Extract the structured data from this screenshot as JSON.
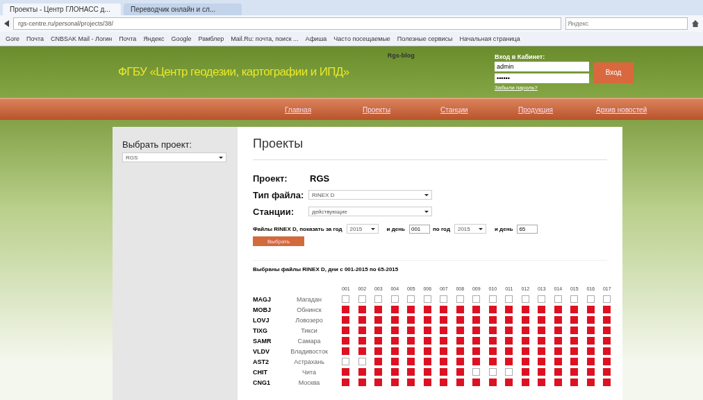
{
  "browser": {
    "tabs": [
      {
        "label": "Проекты - Центр ГЛОНАСС д...",
        "selected": true
      },
      {
        "label": "Переводчик онлайн и сл...",
        "selected": false
      }
    ],
    "address": "rgs-centre.ru/personal/projects/38/",
    "search": {
      "placeholder": "Яндекс"
    },
    "bookmarks": [
      "Gore",
      "Почта",
      "CNBSAK Mail - Логин",
      "Почта",
      "Яндекс",
      "Google",
      "Рамблер",
      "Mail.Ru: почта, поиск ...",
      "Афиша",
      "Часто посещаемые",
      "Полезные сервисы",
      "Начальная страница"
    ]
  },
  "header": {
    "title": "ФГБУ «Центр геодезии, картографии и ИПД»",
    "blog": "Rgs-blog",
    "login_title": "Вход в Кабинет:",
    "login": "admin",
    "password": "••••••",
    "login_button": "Вход",
    "forgot": "Забыли пароль?"
  },
  "nav": [
    {
      "label": "Главная"
    },
    {
      "label": "Проекты"
    },
    {
      "label": "Станции"
    },
    {
      "label": "Продукция"
    },
    {
      "label": "Архив новостей"
    }
  ],
  "sidebar": {
    "label": "Выбрать проект:",
    "value": "RGS"
  },
  "main": {
    "title": "Проекты",
    "project_label": "Проект:",
    "project": "RGS",
    "type_label": "Тип файла:",
    "type": "RINEX D",
    "stations_label": "Станции:",
    "stations": "действующие",
    "filter": {
      "text1": "Файлы RINEX D, показать за год",
      "year1": "2015",
      "text2": "и день",
      "day1": "001",
      "text3": "по год",
      "year2": "2015",
      "text4": "и день",
      "day2": "65"
    },
    "submit": "Выбрать",
    "result": "Выбраны файлы RINEX D, дни с 001-2015 по 65-2015"
  },
  "grid": {
    "columns": [
      "001",
      "002",
      "003",
      "004",
      "005",
      "006",
      "007",
      "008",
      "009",
      "010",
      "011",
      "012",
      "013",
      "014",
      "015",
      "016",
      "017"
    ],
    "rows": [
      {
        "code": "MAGJ",
        "city": "Магадан",
        "cells": [
          false,
          false,
          false,
          false,
          false,
          false,
          false,
          false,
          false,
          false,
          false,
          false,
          false,
          false,
          false,
          false,
          false
        ]
      },
      {
        "code": "MOBJ",
        "city": "Обнинск",
        "cells": [
          true,
          true,
          true,
          true,
          true,
          true,
          true,
          true,
          true,
          true,
          true,
          true,
          true,
          true,
          true,
          true,
          true
        ]
      },
      {
        "code": "LOVJ",
        "city": "Ловозеро",
        "cells": [
          true,
          true,
          true,
          true,
          true,
          true,
          true,
          true,
          true,
          true,
          true,
          true,
          true,
          true,
          true,
          true,
          true
        ]
      },
      {
        "code": "TIXG",
        "city": "Тикси",
        "cells": [
          true,
          true,
          true,
          true,
          true,
          true,
          true,
          true,
          true,
          true,
          true,
          true,
          true,
          true,
          true,
          true,
          true
        ]
      },
      {
        "code": "SAMR",
        "city": "Самара",
        "cells": [
          true,
          true,
          true,
          true,
          true,
          true,
          true,
          true,
          true,
          true,
          true,
          true,
          true,
          true,
          true,
          true,
          true
        ]
      },
      {
        "code": "VLDV",
        "city": "Владивосток",
        "cells": [
          true,
          true,
          true,
          true,
          true,
          true,
          true,
          true,
          true,
          true,
          true,
          true,
          true,
          true,
          true,
          true,
          true
        ]
      },
      {
        "code": "AST2",
        "city": "Астрахань",
        "cells": [
          false,
          false,
          true,
          true,
          true,
          true,
          true,
          true,
          true,
          true,
          true,
          true,
          true,
          true,
          true,
          true,
          true
        ]
      },
      {
        "code": "CHIT",
        "city": "Чита",
        "cells": [
          true,
          true,
          true,
          true,
          true,
          true,
          true,
          true,
          false,
          false,
          false,
          true,
          true,
          true,
          true,
          true,
          true
        ]
      },
      {
        "code": "CNG1",
        "city": "Москва",
        "cells": [
          true,
          true,
          true,
          true,
          true,
          true,
          true,
          true,
          true,
          true,
          true,
          true,
          true,
          true,
          true,
          true,
          true
        ]
      }
    ]
  }
}
